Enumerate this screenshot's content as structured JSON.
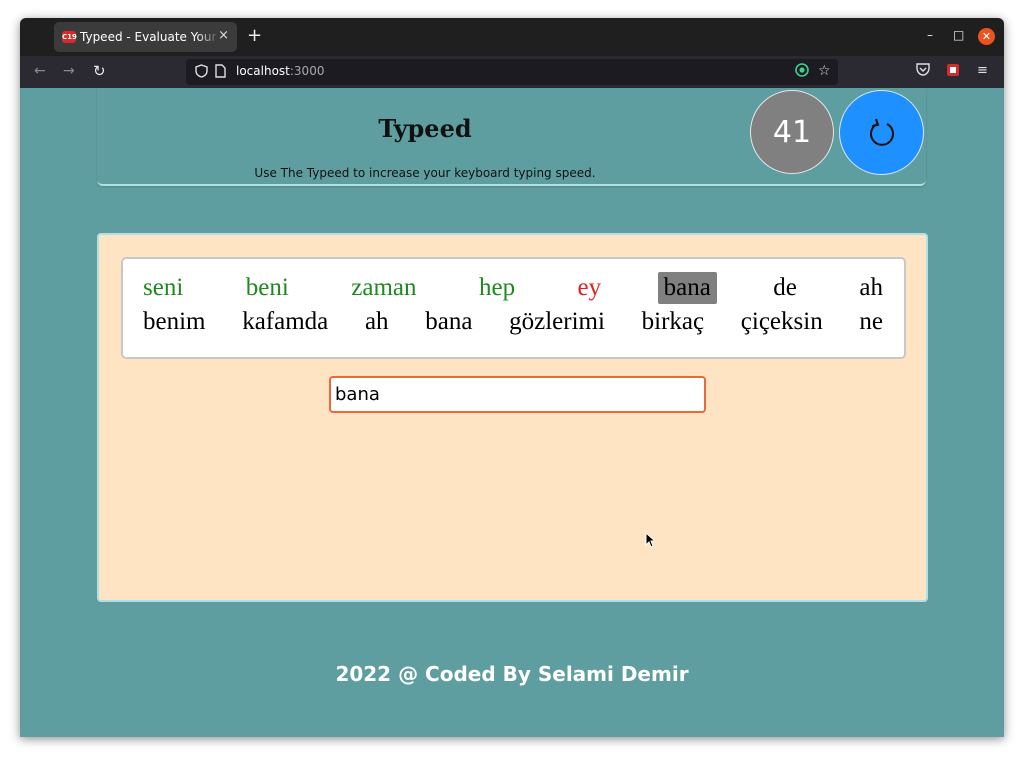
{
  "browser": {
    "tab_title": "Typeed - Evaluate Your Keyboard Typing Speed",
    "favicon_text": "C19",
    "tab_close": "×",
    "new_tab": "+",
    "url_host": "localhost",
    "url_port": ":3000"
  },
  "header": {
    "title": "Typeed",
    "subtitle": "Use The Typeed to increase your keyboard typing speed.",
    "timer": "41"
  },
  "words": {
    "row1": [
      {
        "text": "seni",
        "state": "correct"
      },
      {
        "text": "beni",
        "state": "correct"
      },
      {
        "text": "zaman",
        "state": "correct"
      },
      {
        "text": "hep",
        "state": "correct"
      },
      {
        "text": "ey",
        "state": "wrong"
      },
      {
        "text": "bana",
        "state": "current"
      },
      {
        "text": "de",
        "state": "pending"
      },
      {
        "text": "ah",
        "state": "pending"
      }
    ],
    "row2": [
      {
        "text": "benim",
        "state": "pending"
      },
      {
        "text": "kafamda",
        "state": "pending"
      },
      {
        "text": "ah",
        "state": "pending"
      },
      {
        "text": "bana",
        "state": "pending"
      },
      {
        "text": "gözlerimi",
        "state": "pending"
      },
      {
        "text": "birkaç",
        "state": "pending"
      },
      {
        "text": "çiçeksin",
        "state": "pending"
      },
      {
        "text": "ne",
        "state": "pending"
      }
    ]
  },
  "input": {
    "value": "bana"
  },
  "footer": {
    "text": "2022 @ Coded By Selami Demir"
  },
  "colors": {
    "page_bg": "#5f9ea0",
    "card_bg": "#ffe4c4",
    "correct": "#1e8a1e",
    "wrong": "#e81e1e",
    "current_bg": "#808080",
    "reset_button": "#1e90ff"
  }
}
